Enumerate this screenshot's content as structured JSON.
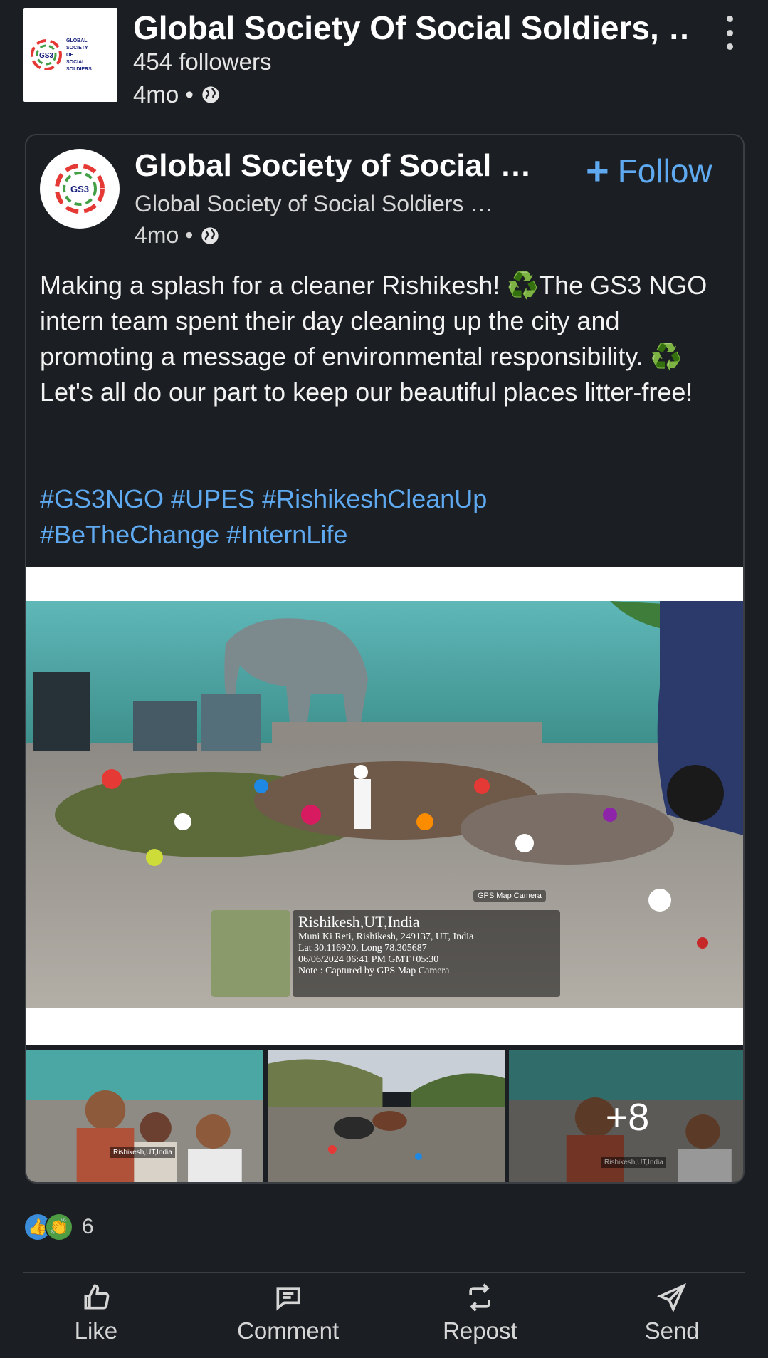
{
  "outer": {
    "title": "Global Society Of Social Soldiers, …",
    "followers": "454 followers",
    "time": "4mo •",
    "logo_text_lines": [
      "GLOBAL",
      "SOCIETY",
      "OF",
      "SOCIAL",
      "SOLDIERS"
    ],
    "logo_mark": "GS3"
  },
  "card": {
    "title": "Global Society of Social …",
    "subtitle": "Global Society of Social Soldiers …",
    "time": "4mo •",
    "follow_label": "Follow",
    "avatar_text": "GS3",
    "post_text": "Making a splash for a cleaner Rishikesh! ♻️The GS3 NGO intern team spent their day cleaning up the city and promoting a message of environmental responsibility. ♻️ Let's all do our part to keep our beautiful places litter-free!",
    "hashtags": [
      "#GS3NGO",
      "#UPES",
      "#RishikeshCleanUp",
      "#BeTheChange",
      "#InternLife"
    ]
  },
  "photo_caption": {
    "badge": "GPS Map Camera",
    "place": "Rishikesh,UT,India",
    "address": "Muni Ki Reti, Rishikesh, 249137, UT, India",
    "coords": "Lat 30.116920, Long 78.305687",
    "datetime": "06/06/2024 06:41 PM GMT+05:30",
    "note": "Note : Captured by GPS Map Camera"
  },
  "thumbs": {
    "more_count": "+8",
    "thumb1_caption": "Rishikesh,UT,India",
    "thumb3_caption": "Rishikesh,UT,India"
  },
  "reactions": {
    "count": "6"
  },
  "actions": [
    {
      "label": "Like",
      "icon": "thumbs-up-icon"
    },
    {
      "label": "Comment",
      "icon": "comment-icon"
    },
    {
      "label": "Repost",
      "icon": "repost-icon"
    },
    {
      "label": "Send",
      "icon": "send-icon"
    }
  ],
  "colors": {
    "background": "#1b1f23",
    "link": "#5ea9f0",
    "card_border": "#3b3f44"
  }
}
